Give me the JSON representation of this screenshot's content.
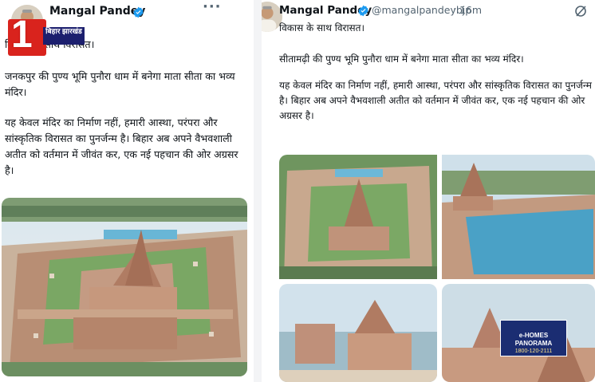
{
  "left_post": {
    "author_name": "Mangal Pandey",
    "more_icon": "more-horizontal-icon",
    "verified_icon": "verified-badge-icon",
    "text_line1": "विकास के साथ विरासत।",
    "paragraph1": "जनकपुर की पुण्य भूमि पुनौरा धाम में बनेगा माता सीता का भव्य मंदिर।",
    "paragraph2": "यह केवल मंदिर का निर्माण नहीं, हमारी आस्था, परंपरा और सांस्कृतिक विरासत का पुनर्जन्म है। बिहार अब अपने वैभवशाली अतीत को वर्तमान में जीवंत कर, एक नई पहचान की ओर अग्रसर है।"
  },
  "channel_logo": {
    "number": "1",
    "text": "बिहार झारखंड"
  },
  "right_post": {
    "close_icon": "close-icon",
    "author_name": "Mangal Pandey",
    "verified_icon": "verified-badge-icon",
    "handle": "@mangalpandeybjp",
    "separator": "·",
    "time": "16m",
    "grok_icon": "grok-icon",
    "text_line1": "विकास के साथ विरासत।",
    "paragraph1": "सीतामढ़ी की पुण्य भूमि पुनौरा धाम में बनेगा माता सीता का भव्य मंदिर।",
    "paragraph2": "यह केवल मंदिर का निर्माण नहीं, हमारी आस्था, परंपरा और सांस्कृतिक विरासत का पुनर्जन्म है। बिहार अब अपने वैभवशाली अतीत को वर्तमान में जीवंत कर, एक नई पहचान की ओर अग्रसर है।"
  },
  "ad_overlay": {
    "line1": "e-HOMES",
    "line2": "PANORAMA",
    "line3": "1800-120-2111"
  },
  "colors": {
    "verified": "#1d9bf0",
    "text": "#0f1419",
    "secondary": "#536471",
    "logo_red": "#d9231d",
    "logo_blue": "#1c1f6e"
  }
}
